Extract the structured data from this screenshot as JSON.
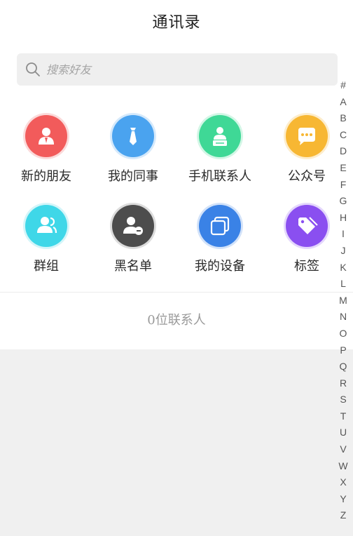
{
  "header": {
    "title": "通讯录"
  },
  "search": {
    "placeholder": "搜索好友"
  },
  "shortcuts": [
    {
      "label": "新的朋友",
      "icon": "new-friend-icon",
      "color": "#f25b5b"
    },
    {
      "label": "我的同事",
      "icon": "colleague-tie-icon",
      "color": "#4aa3ef"
    },
    {
      "label": "手机联系人",
      "icon": "phone-contact-icon",
      "color": "#3fd896"
    },
    {
      "label": "公众号",
      "icon": "chat-bubble-icon",
      "color": "#f7b733"
    },
    {
      "label": "群组",
      "icon": "group-icon",
      "color": "#3fd7e8"
    },
    {
      "label": "黑名单",
      "icon": "blacklist-icon",
      "color": "#4d4d4d"
    },
    {
      "label": "我的设备",
      "icon": "device-icon",
      "color": "#3a82e6"
    },
    {
      "label": "标签",
      "icon": "tag-icon",
      "color": "#8a4ff0"
    }
  ],
  "footer": {
    "contact_count": "0位联系人"
  },
  "index_bar": [
    "#",
    "A",
    "B",
    "C",
    "D",
    "E",
    "F",
    "G",
    "H",
    "I",
    "J",
    "K",
    "L",
    "M",
    "N",
    "O",
    "P",
    "Q",
    "R",
    "S",
    "T",
    "U",
    "V",
    "W",
    "X",
    "Y",
    "Z"
  ]
}
